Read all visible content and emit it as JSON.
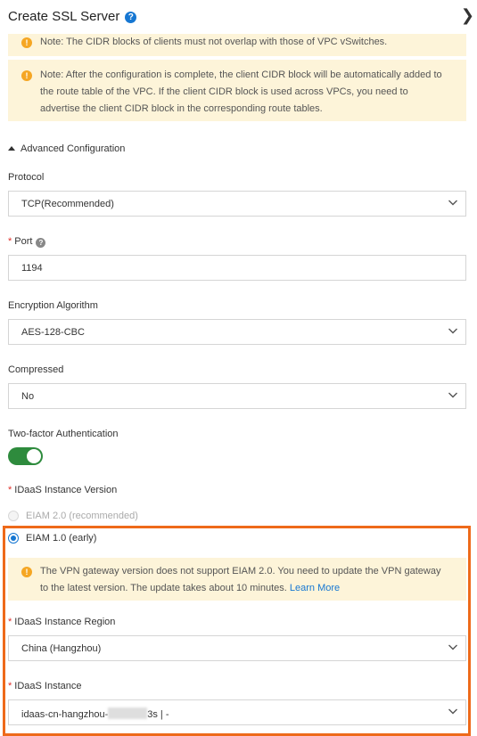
{
  "header": {
    "title": "Create SSL Server",
    "help_icon": "?",
    "close_icon": "×"
  },
  "notices": {
    "cidr_overlap": "Note: The CIDR blocks of clients must not overlap with those of VPC vSwitches.",
    "cidr_route": "Note: After the configuration is complete, the client CIDR block will be automatically added to the route table of the VPC. If the client CIDR block is used across VPCs, you need to advertise the client CIDR block in the corresponding route tables.",
    "eiam_warning": "The VPN gateway version does not support EIAM 2.0. You need to update the VPN gateway to the latest version. The update takes about 10 minutes.",
    "eiam_link": "Learn More"
  },
  "advanced": {
    "label": "Advanced Configuration"
  },
  "form": {
    "protocol": {
      "label": "Protocol",
      "value": "TCP(Recommended)"
    },
    "port": {
      "label": "Port",
      "value": "1194",
      "required": "*"
    },
    "encryption": {
      "label": "Encryption Algorithm",
      "value": "AES-128-CBC"
    },
    "compressed": {
      "label": "Compressed",
      "value": "No"
    },
    "two_factor": {
      "label": "Two-factor Authentication",
      "enabled": true
    },
    "idaas_version": {
      "label": "IDaaS Instance Version",
      "required": "*",
      "options": [
        {
          "label": "EIAM 2.0 (recommended)",
          "disabled": true,
          "selected": false
        },
        {
          "label": "EIAM 1.0 (early)",
          "disabled": false,
          "selected": true
        }
      ]
    },
    "idaas_region": {
      "label": "IDaaS Instance Region",
      "value": "China (Hangzhou)",
      "required": "*"
    },
    "idaas_instance": {
      "label": "IDaaS Instance",
      "value_prefix": "idaas-cn-hangzhou-",
      "value_suffix": "3s | -",
      "required": "*"
    }
  },
  "colors": {
    "accent": "#1677d2",
    "toggle_on": "#2e8b3d",
    "notice_bg": "#fdf4d9",
    "warning": "#f5a623",
    "highlight_border": "#ee6a1a",
    "required": "#e0302a"
  }
}
